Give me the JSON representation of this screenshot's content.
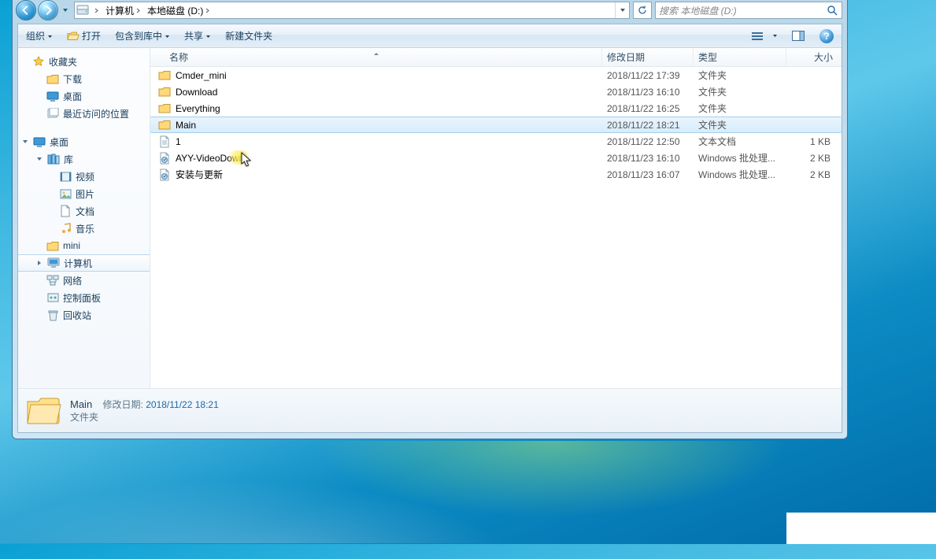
{
  "breadcrumb": {
    "segments": [
      "计算机",
      "本地磁盘 (D:)"
    ]
  },
  "search": {
    "placeholder": "搜索 本地磁盘 (D:)"
  },
  "toolbar": {
    "organize": "组织",
    "open": "打开",
    "include": "包含到库中",
    "share": "共享",
    "newfolder": "新建文件夹"
  },
  "columns": {
    "name": "名称",
    "date": "修改日期",
    "type": "类型",
    "size": "大小"
  },
  "nav": {
    "favorites": "收藏夹",
    "downloads": "下载",
    "desktop": "桌面",
    "recent": "最近访问的位置",
    "desktop2": "桌面",
    "libraries": "库",
    "videos": "视频",
    "pictures": "图片",
    "documents": "文档",
    "music": "音乐",
    "mini": "mini",
    "computer": "计算机",
    "network": "网络",
    "controlpanel": "控制面板",
    "recycle": "回收站"
  },
  "files": [
    {
      "icon": "folder",
      "name": "Cmder_mini",
      "date": "2018/11/22 17:39",
      "type": "文件夹",
      "size": ""
    },
    {
      "icon": "folder",
      "name": "Download",
      "date": "2018/11/23 16:10",
      "type": "文件夹",
      "size": ""
    },
    {
      "icon": "folder",
      "name": "Everything",
      "date": "2018/11/22 16:25",
      "type": "文件夹",
      "size": ""
    },
    {
      "icon": "folder",
      "name": "Main",
      "date": "2018/11/22 18:21",
      "type": "文件夹",
      "size": "",
      "selected": true
    },
    {
      "icon": "text",
      "name": "1",
      "date": "2018/11/22 12:50",
      "type": "文本文档",
      "size": "1 KB"
    },
    {
      "icon": "bat",
      "name": "AYY-VideoDown",
      "date": "2018/11/23 16:10",
      "type": "Windows 批处理...",
      "size": "2 KB",
      "cursor": true
    },
    {
      "icon": "bat",
      "name": "安装与更新",
      "date": "2018/11/23 16:07",
      "type": "Windows 批处理...",
      "size": "2 KB"
    }
  ],
  "details": {
    "name": "Main",
    "date_label": "修改日期:",
    "date_value": "2018/11/22 18:21",
    "type": "文件夹"
  }
}
